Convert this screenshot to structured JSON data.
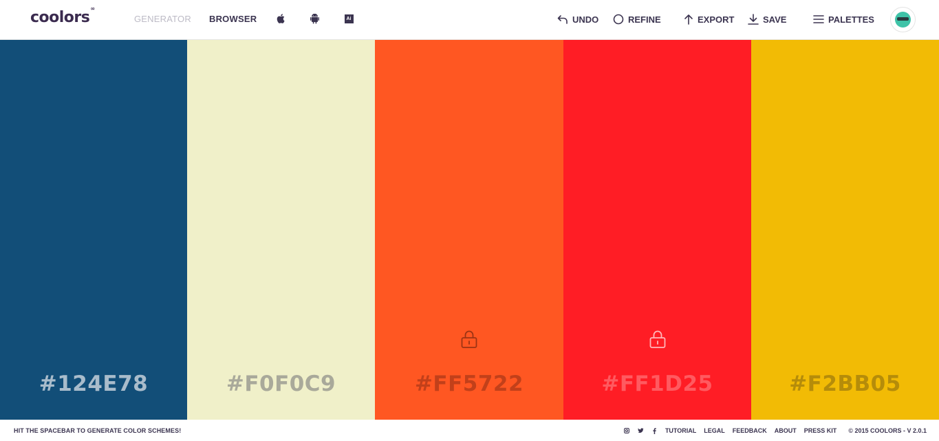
{
  "header": {
    "logo_text": "coolors",
    "logo_sup": "∞",
    "nav": [
      {
        "label": "GENERATOR",
        "active": true
      },
      {
        "label": "BROWSER",
        "active": false
      }
    ],
    "platform_icons": [
      "apple-icon",
      "android-icon",
      "adobe-ai-icon"
    ],
    "ai_label": "Ai",
    "tools": [
      {
        "label": "UNDO",
        "icon": "undo-arrow-icon"
      },
      {
        "label": "REFINE",
        "icon": "circle-icon"
      },
      {
        "label": "EXPORT",
        "icon": "arrow-up-icon"
      },
      {
        "label": "SAVE",
        "icon": "download-icon"
      },
      {
        "label": "PALETTES",
        "icon": "menu-icon"
      }
    ],
    "avatar_icon": "sunglasses-face-icon"
  },
  "palette": [
    {
      "hex": "#124E78",
      "color": "#124e78",
      "text_color": "#a9bccb",
      "locked": false
    },
    {
      "hex": "#F0F0C9",
      "color": "#f0f0c9",
      "text_color": "#a9a99a",
      "locked": false
    },
    {
      "hex": "#FF5722",
      "color": "#ff5722",
      "text_color": "#c2401a",
      "locked": true,
      "lock_color": "#9c3414"
    },
    {
      "hex": "#FF1D25",
      "color": "#ff1d25",
      "text_color": "#ff5a60",
      "locked": true,
      "lock_color": "#ffb8ba"
    },
    {
      "hex": "#F2BB05",
      "color": "#f2bb05",
      "text_color": "#b58c0a",
      "locked": false
    }
  ],
  "footer": {
    "hint": "HIT THE SPACEBAR TO GENERATE COLOR SCHEMES!",
    "social_icons": [
      "instagram-icon",
      "twitter-icon",
      "facebook-icon"
    ],
    "links": [
      "TUTORIAL",
      "LEGAL",
      "FEEDBACK",
      "ABOUT",
      "PRESS KIT"
    ],
    "copyright": "© 2015 COOLORS - V 2.0.1"
  }
}
